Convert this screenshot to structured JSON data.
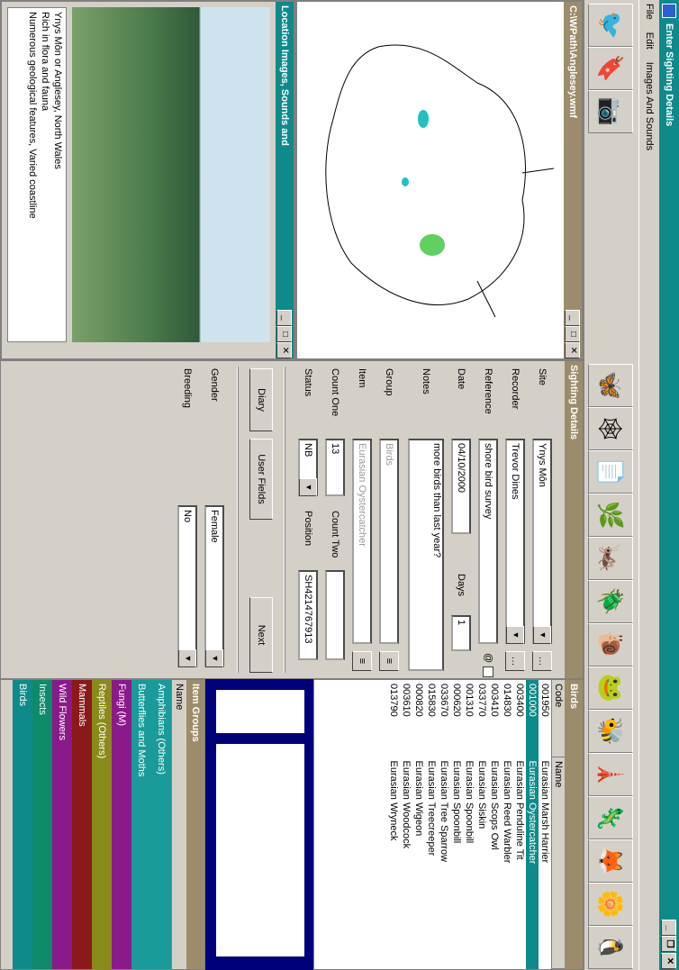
{
  "window": {
    "title": "Enter Sighting Details",
    "min": "_",
    "max": "❐",
    "close": "✕"
  },
  "menu": [
    "File",
    "Edit",
    "Images And Sounds"
  ],
  "toolbar_icons": [
    "bird-icon",
    "bookmark-icon",
    "map-icon",
    "bird-icon",
    "web-icon",
    "notes-icon",
    "plant-icon",
    "grasshopper-icon",
    "dragonfly-icon",
    "snail-icon",
    "frog-icon",
    "butterfly-icon",
    "lighthouse-icon",
    "lizard-icon",
    "fox-icon",
    "flower-icon",
    "bird-icon"
  ],
  "map_window": {
    "title": "C:\\WPath\\Anglesey.wmf"
  },
  "location_window": {
    "title": "Location Images, Sounds and",
    "description": [
      "Ynys Môn or Anglesey, North Wales",
      "Rich in flora and fauna",
      "Numerous geological features, Varied coastline"
    ]
  },
  "sighting": {
    "title": "Sighting Details",
    "site_label": "Site",
    "site_value": "Ynys Môn",
    "recorder_label": "Recorder",
    "recorder_value": "Trevor Dines",
    "reference_label": "Reference",
    "reference_value": "shore bird survey",
    "date_label": "Date",
    "date_value": "04/10/2000",
    "days_label": "Days",
    "days_value": "1",
    "notes_label": "Notes",
    "notes_value": "more birds than last year?",
    "group_label": "Group",
    "group_value": "Birds",
    "item_label": "Item",
    "item_value": "Eurasian Oystercatcher",
    "count_one_label": "Count One",
    "count_one_value": "13",
    "count_two_label": "Count Two",
    "count_two_value": "",
    "status_label": "Status",
    "status_value": "NB",
    "position_label": "Position",
    "position_value": "SH4214767913",
    "diary_button": "Diary",
    "user_fields_button": "User Fields",
    "next_button": "Next",
    "gender_label": "Gender",
    "gender_value": "Female",
    "breeding_label": "Breeding",
    "breeding_value": "No"
  },
  "birds": {
    "title": "Birds",
    "headers": [
      "Code",
      "Name"
    ],
    "rows": [
      {
        "code": "001950",
        "name": "Eurasian Marsh Harrier"
      },
      {
        "code": "001000",
        "name": "Eurasian Oystercatcher"
      },
      {
        "code": "003400",
        "name": "Eurasian Penduline Tit"
      },
      {
        "code": "014830",
        "name": "Eurasian Reed Warbler"
      },
      {
        "code": "003410",
        "name": "Eurasian Scops Owl"
      },
      {
        "code": "033770",
        "name": "Eurasian Siskin"
      },
      {
        "code": "001310",
        "name": "Eurasian Spoonbill"
      },
      {
        "code": "000620",
        "name": "Eurasian Spoonbill"
      },
      {
        "code": "033670",
        "name": "Eurasian Tree Sparrow"
      },
      {
        "code": "015830",
        "name": "Eurasian Treecreeper"
      },
      {
        "code": "000820",
        "name": "Eurasian Wigeon"
      },
      {
        "code": "003610",
        "name": "Eurasian Woodcock"
      },
      {
        "code": "013790",
        "name": "Eurasian Wryneck"
      }
    ]
  },
  "groups": {
    "title": "Item Groups",
    "header": "Name",
    "items": [
      {
        "name": "Amphibians (Others)",
        "color": "#1a9a9a"
      },
      {
        "name": "Butterflies and Moths",
        "color": "#1a9a9a"
      },
      {
        "name": "Fungi (M)",
        "color": "#8a1a8a"
      },
      {
        "name": "Reptiles (Others)",
        "color": "#8a8a1a"
      },
      {
        "name": "Mammals",
        "color": "#8a1a1a"
      },
      {
        "name": "Wild Flowers",
        "color": "#8a1a8a"
      },
      {
        "name": "Insects",
        "color": "#0f8a6a"
      },
      {
        "name": "Birds",
        "color": "#0f8a8a"
      }
    ]
  }
}
